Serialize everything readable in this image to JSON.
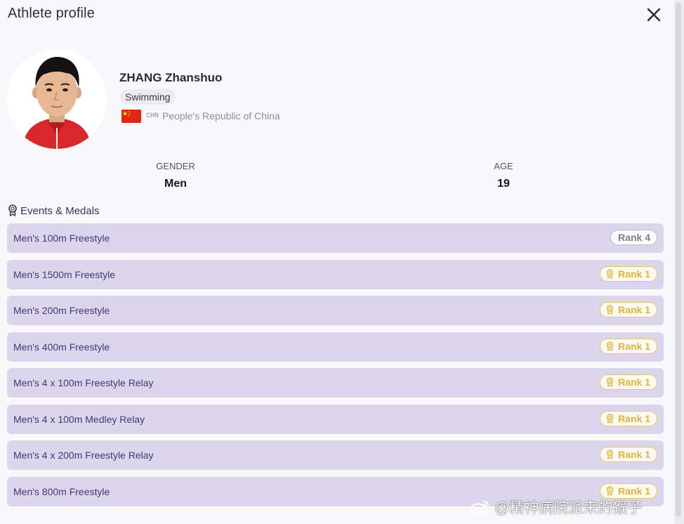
{
  "header": {
    "title": "Athlete profile"
  },
  "athlete": {
    "name": "ZHANG Zhanshuo",
    "sport": "Swimming",
    "noc_code": "CHN",
    "country": "People's Republic of China"
  },
  "stats": {
    "gender_label": "GENDER",
    "gender_value": "Men",
    "age_label": "AGE",
    "age_value": "19"
  },
  "events_section": {
    "title": "Events & Medals"
  },
  "events": [
    {
      "name": "Men's 100m Freestyle",
      "rank": "Rank 4",
      "medal": false
    },
    {
      "name": "Men's 1500m Freestyle",
      "rank": "Rank 1",
      "medal": true
    },
    {
      "name": "Men's 200m Freestyle",
      "rank": "Rank 1",
      "medal": true
    },
    {
      "name": "Men's 400m Freestyle",
      "rank": "Rank 1",
      "medal": true
    },
    {
      "name": "Men's 4 x 100m Freestyle Relay",
      "rank": "Rank 1",
      "medal": true
    },
    {
      "name": "Men's 4 x 100m Medley Relay",
      "rank": "Rank 1",
      "medal": true
    },
    {
      "name": "Men's 4 x 200m Freestyle Relay",
      "rank": "Rank 1",
      "medal": true
    },
    {
      "name": "Men's 800m Freestyle",
      "rank": "Rank 1",
      "medal": true
    }
  ],
  "watermark": {
    "text": "@精神病院派来的猴子"
  },
  "colors": {
    "event_row_bg": "#dcd6ec",
    "event_text": "#3c3a78",
    "gold": "#e0b33e",
    "flag_red": "#de2910",
    "flag_star": "#ffde00"
  },
  "icons": {
    "close": "close-icon",
    "medal": "medal-icon",
    "flag": "china-flag-icon",
    "weibo": "weibo-icon"
  }
}
